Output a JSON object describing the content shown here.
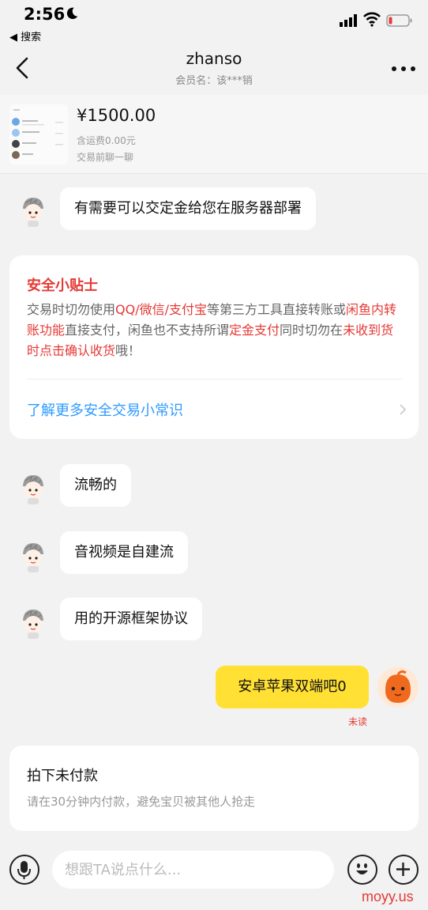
{
  "status": {
    "time": "2:56",
    "back_app": "◀ 搜索"
  },
  "nav": {
    "title": "zhanso",
    "subtitle": "会员名：该***销"
  },
  "product": {
    "price": "¥1500.00",
    "shipping": "含运费0.00元",
    "hint": "交易前聊一聊"
  },
  "messages": {
    "m1": "有需要可以交定金给您在服务器部署",
    "m2": "流畅的",
    "m3": "音视频是自建流",
    "m4": "用的开源框架协议",
    "mine": "安卓苹果双端吧0",
    "mine_status": "未读"
  },
  "tips": {
    "title": "安全小贴士",
    "segments": [
      {
        "text": "交易时切勿使用",
        "red": false
      },
      {
        "text": "QQ/微信/支付宝",
        "red": true
      },
      {
        "text": "等第三方工具直接转账或",
        "red": false
      },
      {
        "text": "闲鱼内转账功能",
        "red": true
      },
      {
        "text": "直接支付，闲鱼也不支持所谓",
        "red": false
      },
      {
        "text": "定金支付",
        "red": true
      },
      {
        "text": "同时切勿在",
        "red": false
      },
      {
        "text": "未收到货时点击确认收货",
        "red": true
      },
      {
        "text": "哦！",
        "red": false
      }
    ],
    "link": "了解更多安全交易小常识"
  },
  "unpaid": {
    "title": "拍下未付款",
    "desc": "请在30分钟内付款，避免宝贝被其他人抢走"
  },
  "input": {
    "placeholder": "想跟TA说点什么..."
  },
  "watermark": "moyy.us",
  "colors": {
    "accent_red": "#e53935",
    "link_blue": "#2e9bff",
    "my_bubble": "#ffe033",
    "background": "#f2f2f2"
  }
}
